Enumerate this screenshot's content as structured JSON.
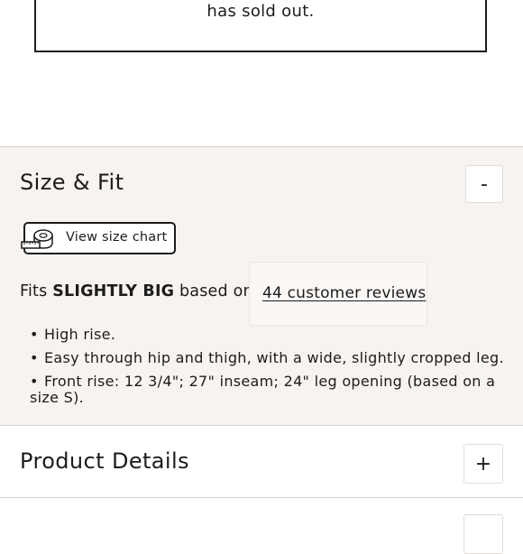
{
  "sold_out": {
    "text": "has sold out."
  },
  "size_fit": {
    "title": "Size & Fit",
    "toggle": "-",
    "size_chart_label": "View size chart",
    "fit": {
      "prefix": "Fits",
      "verdict": "SLIGHTLY BIG",
      "middle": "based on",
      "reviews_link": "44 customer reviews"
    },
    "bullets": [
      "High rise.",
      "Easy through hip and thigh, with a wide, slightly cropped leg.",
      "Front rise: 12 3/4\"; 27\" inseam; 24\" leg opening (based on a size S)."
    ],
    "bullet_glyph": "•"
  },
  "product_details": {
    "title": "Product Details",
    "toggle": "+"
  },
  "icons": {
    "size_chart": "measuring-tape-icon"
  }
}
